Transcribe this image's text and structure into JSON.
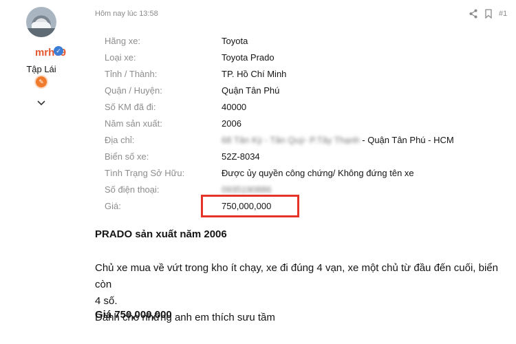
{
  "author": {
    "username": "mrh09",
    "rank": "Tập Lái",
    "icons": {
      "avatar": "car-avatar-image",
      "verified": "verified-badge-icon",
      "rank_badge": "rank-badge-icon",
      "expand": "chevron-down-icon"
    }
  },
  "post": {
    "timestamp": "Hôm nay lúc 13:58",
    "number": "#1",
    "actions": {
      "share": "share-icon",
      "bookmark": "bookmark-icon"
    }
  },
  "details": [
    {
      "label": "Hãng xe:",
      "value": "Toyota"
    },
    {
      "label": "Loại xe:",
      "value": "Toyota Prado"
    },
    {
      "label": "Tỉnh / Thành:",
      "value": "TP. Hồ Chí Minh"
    },
    {
      "label": "Quận / Huyện:",
      "value": "Quận Tân Phú"
    },
    {
      "label": "Số KM đã đi:",
      "value": "40000"
    },
    {
      "label": "Năm sản xuất:",
      "value": "2006"
    },
    {
      "label": "Địa chỉ:",
      "value_blurred": "68 Tân Kỳ - Tân Quý- P.Tây Thạnh",
      "value": " - Quận Tân Phú - HCM"
    },
    {
      "label": "Biển số xe:",
      "value": "52Z-8034"
    },
    {
      "label": "Tình Trạng Sở Hữu:",
      "value": "Được ủy quyền công chứng/ Không đứng tên xe"
    },
    {
      "label": "Số điện thoại:",
      "value_blurred": "0935190886"
    },
    {
      "label": "Giá:",
      "value": "750,000,000"
    }
  ],
  "content": {
    "heading": "PRADO sản xuất năm 2006",
    "paragraph_line1": "Chủ xe mua về vứt trong kho ít chạy, xe đi đúng 4 vạn, xe một chủ từ đầu đến cuối, biển còn",
    "paragraph_line2": "4 số.",
    "paragraph_line3": "Dành cho những anh em thích sưu tầm",
    "price_line": "Giá 750,000,000"
  },
  "colors": {
    "username": "#e4572e",
    "highlight_box": "#e53327",
    "label": "#8d8d8d",
    "meta": "#8a8a8a"
  }
}
